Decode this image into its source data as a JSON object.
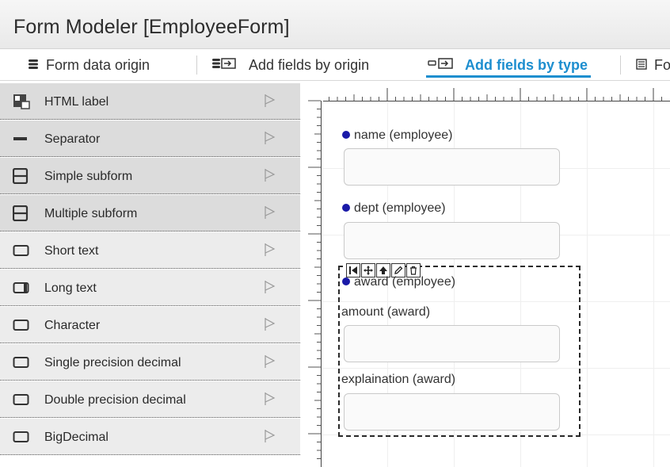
{
  "window": {
    "title": "Form Modeler [EmployeeForm]"
  },
  "tabs": [
    {
      "label": "Form data origin",
      "icon": "database-icon"
    },
    {
      "label": "Add fields by origin",
      "icon": "database-add-icon"
    },
    {
      "label": "Add fields by type",
      "icon": "input-add-icon",
      "active": true
    },
    {
      "label": "Fo",
      "icon": "form-properties-icon"
    }
  ],
  "palette": {
    "items": [
      {
        "label": "HTML label",
        "icon": "html-label-icon",
        "group": "basic"
      },
      {
        "label": "Separator",
        "icon": "separator-icon",
        "group": "basic"
      },
      {
        "label": "Simple subform",
        "icon": "subform-icon",
        "group": "basic"
      },
      {
        "label": "Multiple subform",
        "icon": "subform-icon",
        "group": "basic"
      },
      {
        "label": "Short text",
        "icon": "textbox-icon",
        "group": "field"
      },
      {
        "label": "Long text",
        "icon": "textarea-icon",
        "group": "field"
      },
      {
        "label": "Character",
        "icon": "textbox-icon",
        "group": "field"
      },
      {
        "label": "Single precision decimal",
        "icon": "textbox-icon",
        "group": "field"
      },
      {
        "label": "Double precision decimal",
        "icon": "textbox-icon",
        "group": "field"
      },
      {
        "label": "BigDecimal",
        "icon": "textbox-icon",
        "group": "field"
      }
    ]
  },
  "canvas": {
    "fields": [
      {
        "label": "name (employee)",
        "required": true
      },
      {
        "label": "dept (employee)",
        "required": true
      }
    ],
    "subform": {
      "label": "award (employee)",
      "required": true,
      "toolbar": [
        "move-first-icon",
        "move-icon",
        "move-up-icon",
        "edit-icon",
        "delete-icon"
      ],
      "fields": [
        {
          "label": "amount (award)"
        },
        {
          "label": "explaination (award)"
        }
      ]
    }
  },
  "colors": {
    "accent": "#1d8ecf",
    "required_dot": "#1a1aa8"
  }
}
